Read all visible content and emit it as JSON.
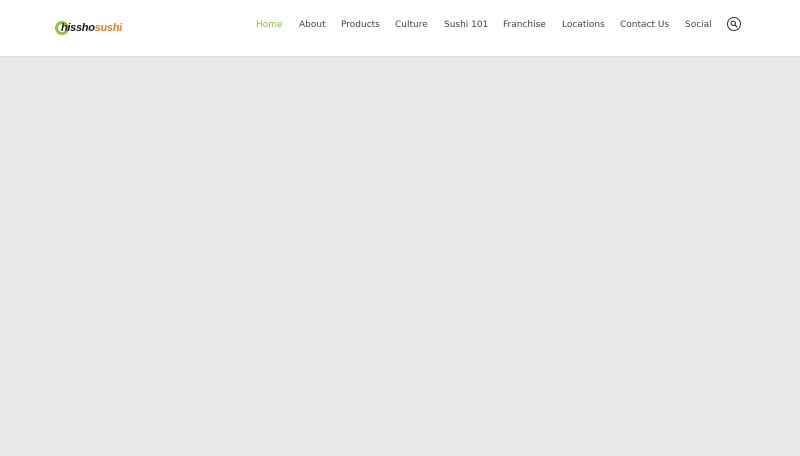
{
  "logo": {
    "text_part1": "hissho",
    "text_part2": "sushi",
    "color_primary": "#1e1e1e",
    "color_accent": "#f07d1a",
    "mark_color": "#8cc63f"
  },
  "nav": {
    "active_color": "#8cc63f",
    "items": [
      {
        "label": "Home"
      },
      {
        "label": "About"
      },
      {
        "label": "Products"
      },
      {
        "label": "Culture"
      },
      {
        "label": "Sushi 101"
      },
      {
        "label": "Franchise"
      },
      {
        "label": "Locations"
      },
      {
        "label": "Contact Us"
      },
      {
        "label": "Social"
      }
    ]
  },
  "search": {
    "icon": "search-icon"
  }
}
